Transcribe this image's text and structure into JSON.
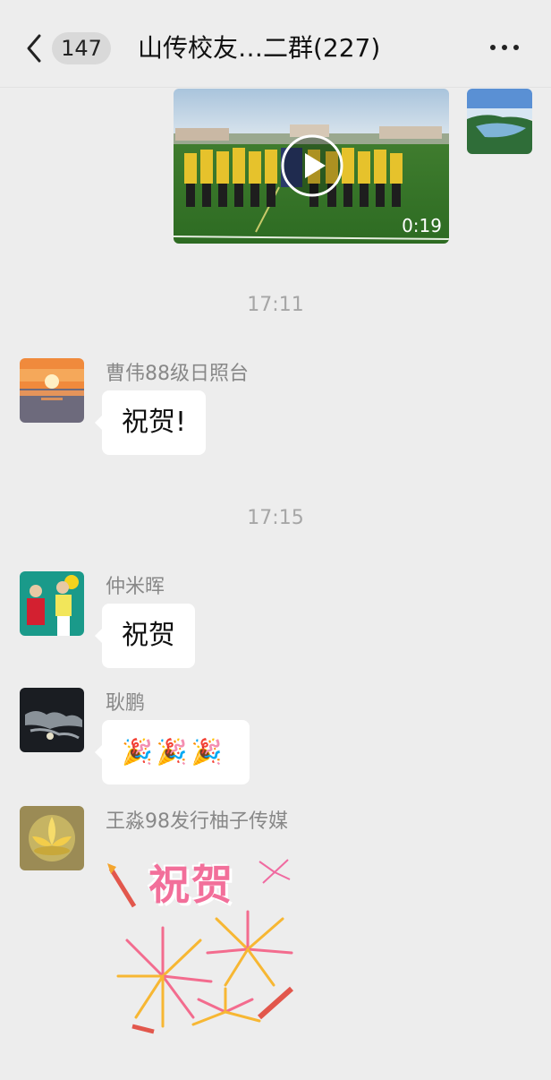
{
  "header": {
    "unread_count": "147",
    "title": "山传校友…二群(227)"
  },
  "video_message": {
    "duration": "0:19"
  },
  "timestamps": [
    "17:11",
    "17:15"
  ],
  "messages": [
    {
      "sender": "曹伟88级日照台",
      "text": "祝贺!"
    },
    {
      "sender": "仲米晖",
      "text": "祝贺"
    },
    {
      "sender": "耿鹏",
      "text": "🎉🎉🎉"
    },
    {
      "sender": "王淼98发行柚子传媒",
      "sticker_text": "祝贺"
    }
  ],
  "colors": {
    "background": "#ededed",
    "bubble": "#ffffff",
    "timestamp": "#a6a6a6",
    "sender": "#888888"
  }
}
